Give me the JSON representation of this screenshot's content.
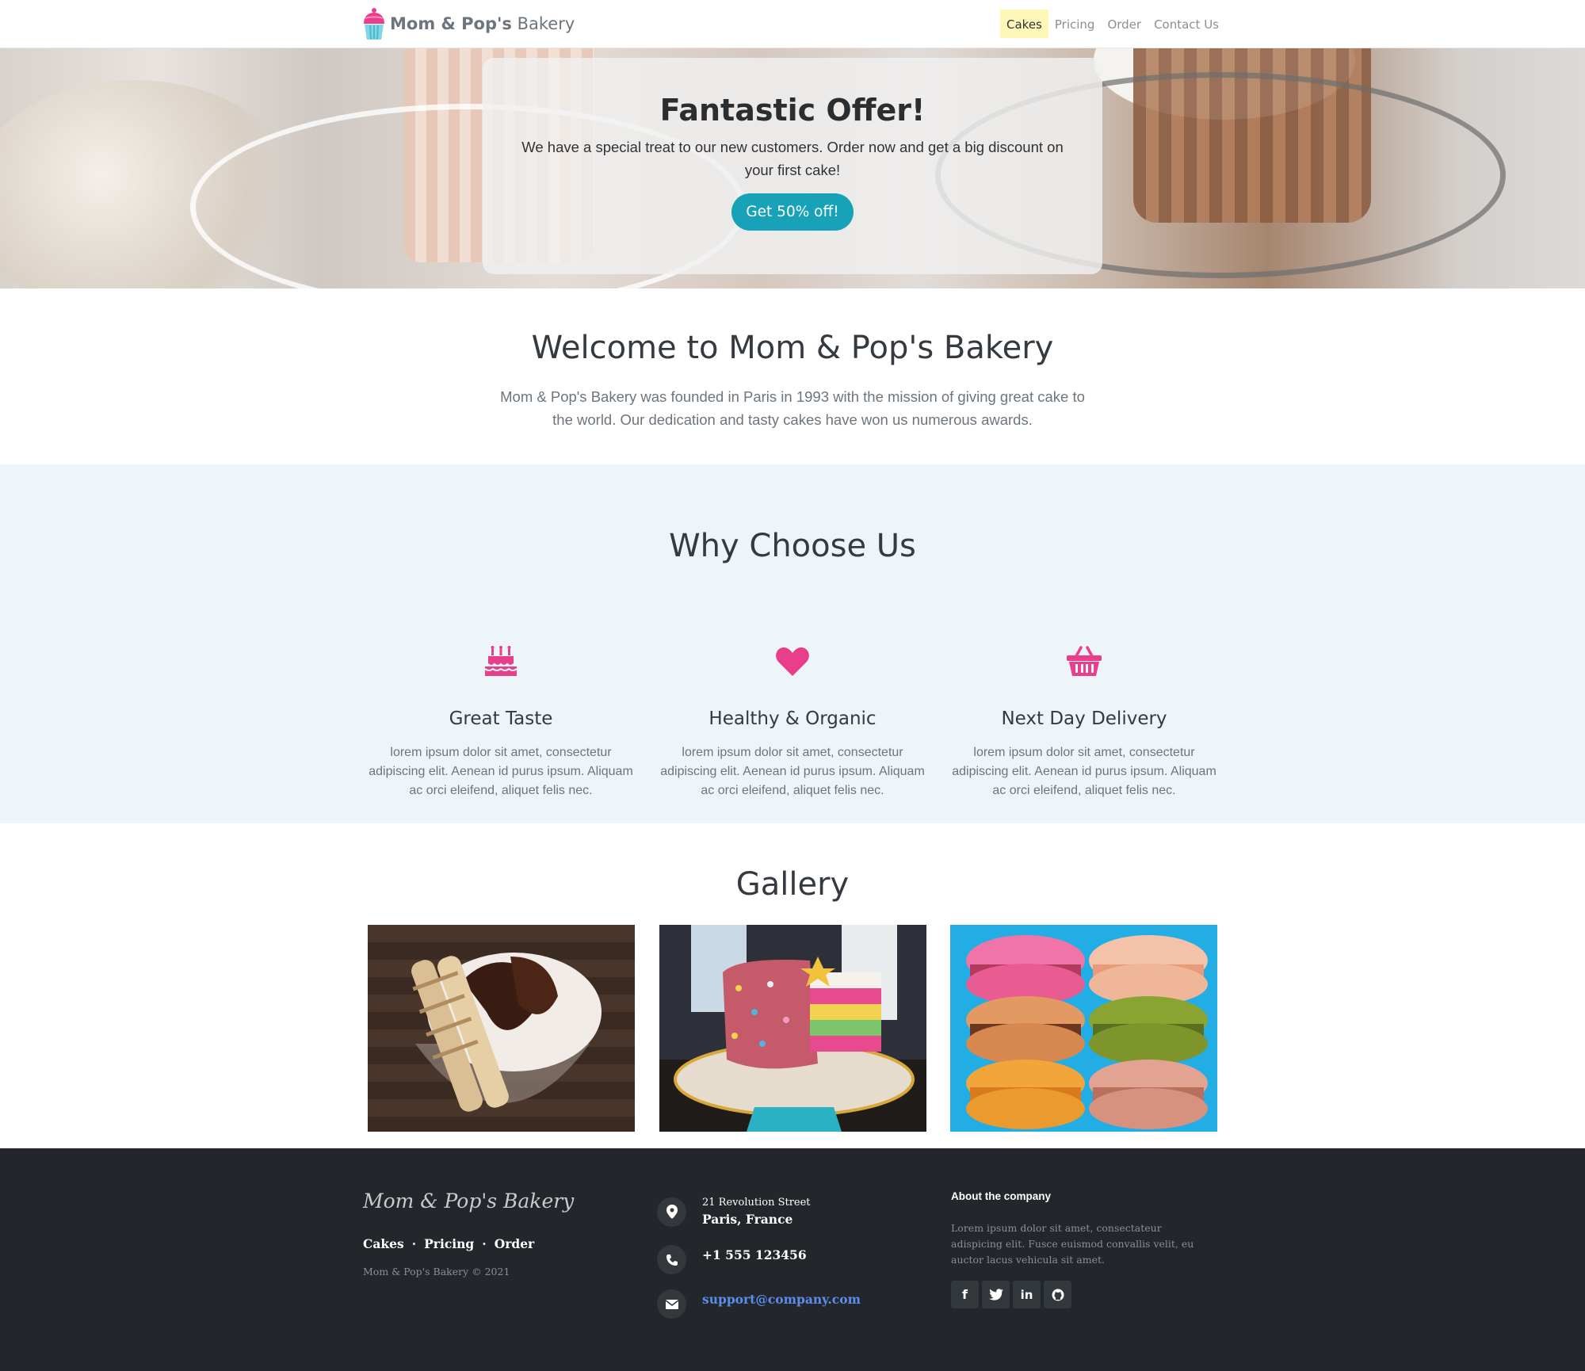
{
  "navbar": {
    "brand_bold": "Mom & Pop's",
    "brand_light": " Bakery",
    "links": [
      "Cakes",
      "Pricing",
      "Order",
      "Contact Us"
    ]
  },
  "hero": {
    "title": "Fantastic Offer!",
    "text": "We have a special treat to our new customers. Order now and get a big discount on your first cake!",
    "button": "Get 50% off!"
  },
  "welcome": {
    "title": "Welcome to Mom & Pop's Bakery",
    "text": "Mom & Pop's Bakery was founded in Paris in 1993 with the mission of giving great cake to the world. Our dedication and tasty cakes have won us numerous awards."
  },
  "why": {
    "title": "Why Choose Us",
    "features": [
      {
        "icon": "birthday-cake-icon",
        "title": "Great Taste",
        "text": "lorem ipsum dolor sit amet, consectetur adipiscing elit. Aenean id purus ipsum. Aliquam ac orci eleifend, aliquet felis nec."
      },
      {
        "icon": "heart-icon",
        "title": "Healthy & Organic",
        "text": "lorem ipsum dolor sit amet, consectetur adipiscing elit. Aenean id purus ipsum. Aliquam ac orci eleifend, aliquet felis nec."
      },
      {
        "icon": "shopping-basket-icon",
        "title": "Next Day Delivery",
        "text": "lorem ipsum dolor sit amet, consectetur adipiscing elit. Aenean id purus ipsum. Aliquam ac orci eleifend, aliquet felis nec."
      }
    ]
  },
  "gallery": {
    "title": "Gallery"
  },
  "footer": {
    "brand": "Mom & Pop's Bakery",
    "links": [
      "Cakes",
      "Pricing",
      "Order"
    ],
    "separator": "·",
    "copyright": "Mom & Pop's Bakery © 2021",
    "address_line1": "21 Revolution Street",
    "address_line2": "Paris, France",
    "phone": "+1 555 123456",
    "email": "support@company.com",
    "about_title": "About the company",
    "about_text": "Lorem ipsum dolor sit amet, consectateur adispicing elit. Fusce euismod convallis velit, eu auctor lacus vehicula sit amet.",
    "social": [
      "facebook-icon",
      "twitter-icon",
      "linkedin-icon",
      "github-icon"
    ]
  },
  "colors": {
    "accent": "#e83e8c",
    "button": "#17a2b8",
    "active_nav": "#fdf8b8",
    "footer_bg": "#23272b",
    "email_link": "#5b8def"
  }
}
